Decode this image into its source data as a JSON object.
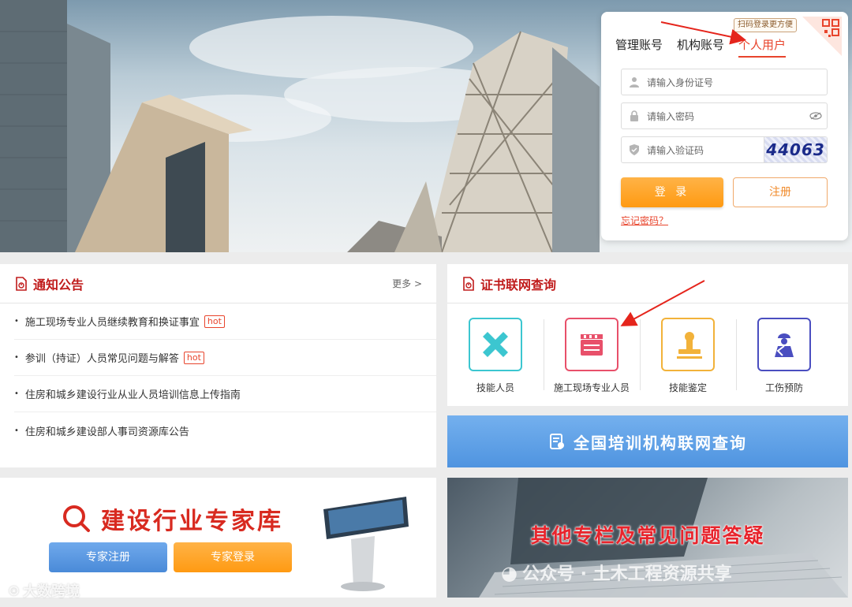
{
  "login": {
    "qr_tip": "扫码登录更方便",
    "tabs": [
      "管理账号",
      "机构账号",
      "个人用户"
    ],
    "active_tab": "个人用户",
    "id_placeholder": "请输入身份证号",
    "password_placeholder": "请输入密码",
    "captcha_placeholder": "请输入验证码",
    "captcha_text": "44063",
    "login_button": "登 录",
    "register_button": "注册",
    "forgot_link": "忘记密码？"
  },
  "notice": {
    "title": "通知公告",
    "more": "更多 >",
    "items": [
      {
        "text": "施工现场专业人员继续教育和换证事宜",
        "badge": "hot"
      },
      {
        "text": "参训（持证）人员常见问题与解答",
        "badge": "hot"
      },
      {
        "text": "住房和城乡建设行业从业人员培训信息上传指南",
        "badge": ""
      },
      {
        "text": "住房和城乡建设部人事司资源库公告",
        "badge": ""
      }
    ]
  },
  "cert_query": {
    "title": "证书联网查询",
    "items": [
      {
        "label": "技能人员",
        "icon": "tools-cross-icon",
        "color": "#3cc6d0"
      },
      {
        "label": "施工现场专业人员",
        "icon": "clapperboard-icon",
        "color": "#e8506a"
      },
      {
        "label": "技能鉴定",
        "icon": "stamp-icon",
        "color": "#f2b23a"
      },
      {
        "label": "工伤预防",
        "icon": "injured-worker-icon",
        "color": "#4a4ec0"
      }
    ]
  },
  "national_query": {
    "label": "全国培训机构联网查询"
  },
  "expert": {
    "title": "建设行业专家库",
    "register": "专家注册",
    "login": "专家登录"
  },
  "other": {
    "title": "其他专栏及常见问题答疑"
  },
  "watermarks": {
    "right": "公众号 · 土木工程资源共享",
    "left": "大数跨境"
  },
  "colors": {
    "brand_red": "#c01b1b",
    "accent_orange": "#ff9a12",
    "blue": "#4f94e0"
  }
}
